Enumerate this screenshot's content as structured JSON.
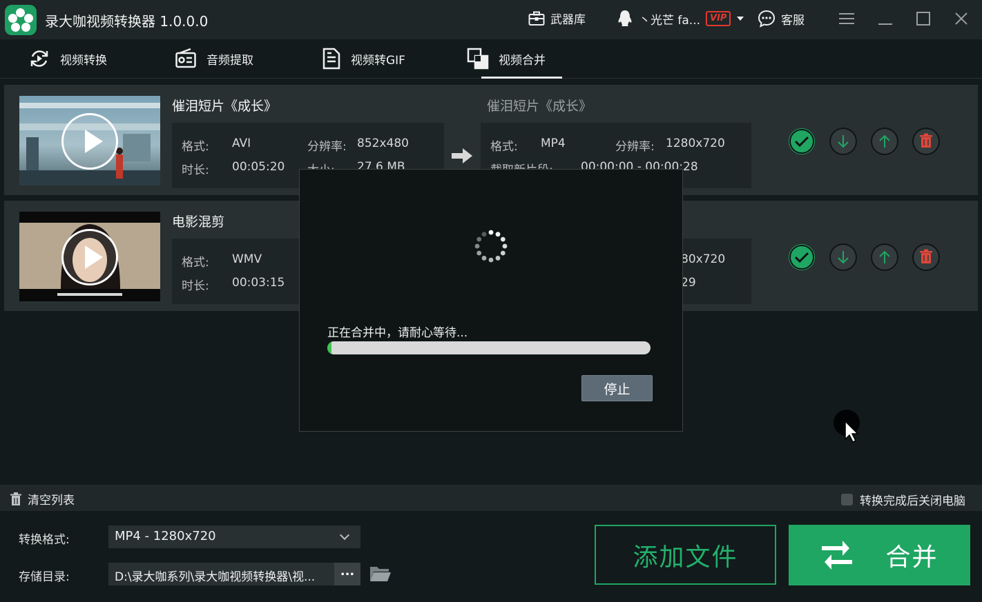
{
  "app": {
    "title": "录大咖视频转换器 1.0.0.0",
    "accent": "#1fa663"
  },
  "titlebar": {
    "arsenal_label": "武器库",
    "user_name": "丶光芒 fa...",
    "vip_badge": "VIP",
    "support_label": "客服"
  },
  "tabs": [
    {
      "label": "视频转换",
      "icon": "convert-icon"
    },
    {
      "label": "音频提取",
      "icon": "radio-icon"
    },
    {
      "label": "视频转GIF",
      "icon": "document-icon"
    },
    {
      "label": "视频合并",
      "icon": "merge-icon",
      "active": true
    }
  ],
  "files": [
    {
      "title": "催泪短片《成长》",
      "format_label": "格式:",
      "format": "AVI",
      "resolution_label": "分辨率:",
      "resolution": "852x480",
      "duration_label": "时长:",
      "duration": "00:05:20",
      "size_label": "大小:",
      "size": "27.6 MB",
      "output": {
        "title": "催泪短片《成长》",
        "format_label": "格式:",
        "format": "MP4",
        "resolution_label": "分辨率:",
        "resolution": "1280x720",
        "clip_label": "截取新片段:",
        "clip": "00:00:00 - 00:00:28"
      }
    },
    {
      "title": "电影混剪",
      "format_label": "格式:",
      "format": "WMV",
      "duration_label": "时长:",
      "duration": "00:03:15",
      "output": {
        "resolution_partial": "80x720",
        "clip_partial": "29"
      }
    }
  ],
  "modal": {
    "message": "正在合并中，请耐心等待...",
    "progress": 0.012,
    "stop_label": "停止"
  },
  "bottom": {
    "clear_list_label": "清空列表",
    "shutdown_label": "转换完成后关闭电脑",
    "shutdown_checked": false,
    "format_label": "转换格式:",
    "format_value": "MP4 - 1280x720",
    "dir_label": "存储目录:",
    "dir_value": "D:\\录大咖系列\\录大咖视频转换器\\视...",
    "browse_label": "...",
    "add_file_label": "添加文件",
    "merge_label": "合并"
  }
}
